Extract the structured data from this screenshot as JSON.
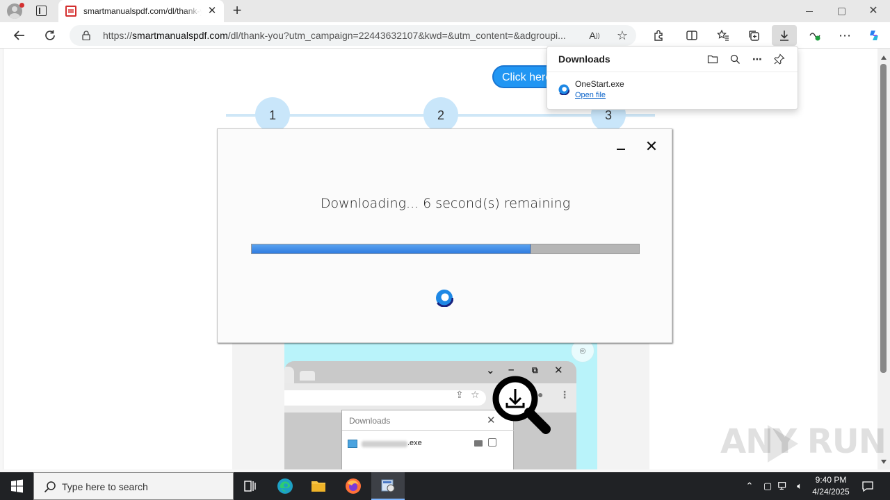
{
  "browser": {
    "tab": {
      "title": "smartmanualspdf.com/dl/thank-you?utm_campaign"
    },
    "address": {
      "prefix": "https://",
      "domain": "smartmanualspdf.com",
      "path": "/dl/thank-you?utm_campaign=22443632107&kwd=&utm_content=&adgroupi..."
    }
  },
  "downloads_panel": {
    "title": "Downloads",
    "item": {
      "file_name": "OneStart.exe",
      "action": "Open file"
    }
  },
  "page": {
    "cta_label": "Click here",
    "steps": [
      "1",
      "2",
      "3"
    ],
    "modal": {
      "message": "Downloading... 6 second(s) remaining",
      "progress": 0.72
    },
    "guide": {
      "downloads_title": "Downloads",
      "file_ext": ".exe"
    }
  },
  "watermark": "ANY RUN",
  "taskbar": {
    "search_placeholder": "Type here to search",
    "time": "9:40 PM",
    "date": "4/24/2025"
  },
  "colors": {
    "accent": "#2f7be0",
    "cta": "#2196f3",
    "step": "#c9e6fa",
    "taskbar": "#202225"
  }
}
